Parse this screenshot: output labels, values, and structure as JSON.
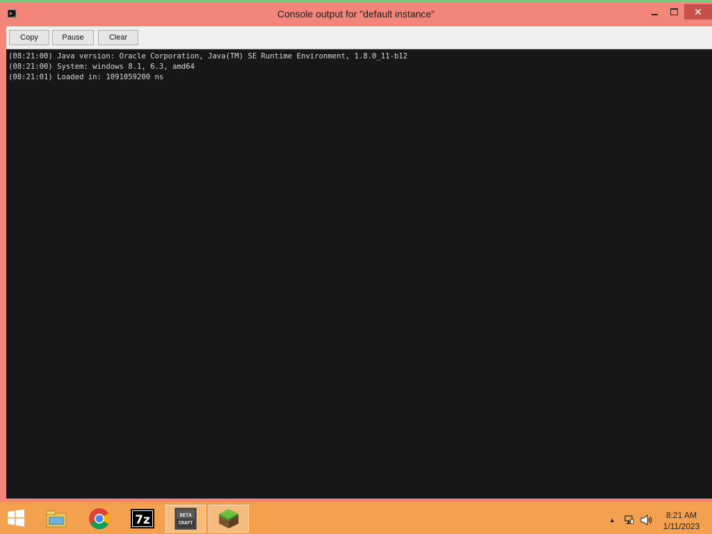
{
  "window": {
    "title": "Console output for \"default instance\""
  },
  "toolbar": {
    "copy_label": "Copy",
    "pause_label": "Pause",
    "clear_label": "Clear"
  },
  "console": {
    "lines": [
      "(08:21:00) Java version: Oracle Corporation, Java(TM) SE Runtime Environment, 1.8.0_11-b12",
      "(08:21:00) System: windows 8.1, 6.3, amd64",
      "(08:21:01) Loaded in: 1091059200 ns"
    ]
  },
  "taskbar": {
    "items": [
      {
        "name": "file-explorer-icon",
        "label": ""
      },
      {
        "name": "chrome-icon",
        "label": ""
      },
      {
        "name": "7zip-icon",
        "label": "7z"
      },
      {
        "name": "betacraft-icon",
        "label": "BETA CRAFT"
      },
      {
        "name": "minecraft-icon",
        "label": ""
      }
    ],
    "clock_time": "8:21 AM",
    "clock_date": "1/11/2023"
  },
  "colors": {
    "titlebar": "#f3857a",
    "close_button": "#c7514a",
    "console_bg": "#171717",
    "console_text": "#d8d8d8",
    "taskbar": "#f3a14e"
  }
}
